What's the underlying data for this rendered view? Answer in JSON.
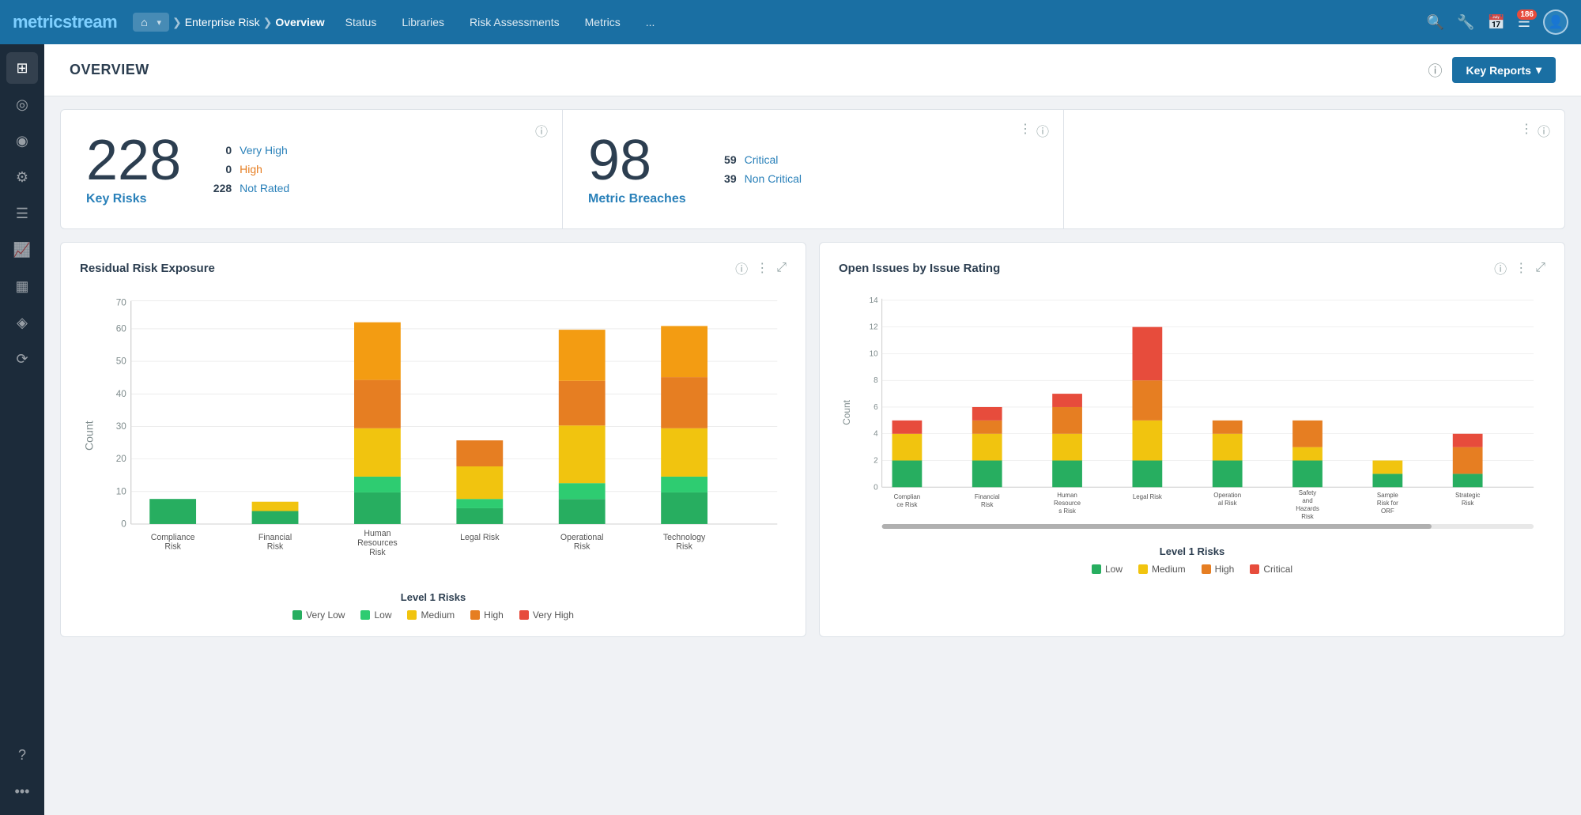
{
  "brand": {
    "name": "metricstream"
  },
  "nav": {
    "home_label": "⌂",
    "breadcrumb": [
      "Enterprise Risk",
      "Overview"
    ],
    "links": [
      "Status",
      "Libraries",
      "Risk Assessments",
      "Metrics"
    ],
    "active": "Overview",
    "more": "..."
  },
  "header": {
    "title": "OVERVIEW",
    "help_icon": "?",
    "key_reports_label": "Key Reports",
    "key_reports_dropdown": "▾"
  },
  "metrics": {
    "key_risks": {
      "count": "228",
      "label": "Key Risks",
      "very_high_count": "0",
      "very_high_label": "Very High",
      "high_count": "0",
      "high_label": "High",
      "not_rated_count": "228",
      "not_rated_label": "Not Rated"
    },
    "metric_breaches": {
      "count": "98",
      "label": "Metric Breaches",
      "critical_count": "59",
      "critical_label": "Critical",
      "non_critical_count": "39",
      "non_critical_label": "Non Critical"
    }
  },
  "residual_chart": {
    "title": "Residual Risk Exposure",
    "y_label": "Count",
    "x_label": "Level 1 Risks",
    "y_max": 70,
    "y_ticks": [
      0,
      10,
      20,
      30,
      40,
      50,
      60,
      70
    ],
    "bars": [
      {
        "label": "Compliance Risk",
        "very_low": 8,
        "low": 0,
        "medium": 0,
        "high": 0,
        "very_high": 0
      },
      {
        "label": "Financial Risk",
        "very_low": 4,
        "low": 0,
        "medium": 3,
        "high": 0,
        "very_high": 0
      },
      {
        "label": "Human Resources Risk",
        "very_low": 10,
        "low": 5,
        "medium": 15,
        "high": 15,
        "very_high": 18
      },
      {
        "label": "Legal Risk",
        "very_low": 5,
        "low": 3,
        "medium": 10,
        "high": 8,
        "very_high": 0
      },
      {
        "label": "Operational Risk",
        "very_low": 8,
        "low": 5,
        "medium": 18,
        "high": 14,
        "very_high": 16
      },
      {
        "label": "Technology Risk",
        "very_low": 10,
        "low": 5,
        "medium": 15,
        "high": 16,
        "very_high": 16
      }
    ],
    "legend": [
      {
        "label": "Very Low",
        "color": "#27ae60"
      },
      {
        "label": "Low",
        "color": "#2ecc71"
      },
      {
        "label": "Medium",
        "color": "#f1c40f"
      },
      {
        "label": "High",
        "color": "#e67e22"
      },
      {
        "label": "Very High",
        "color": "#e74c3c"
      }
    ]
  },
  "issues_chart": {
    "title": "Open Issues by Issue Rating",
    "y_label": "Count",
    "x_label": "Level 1 Risks",
    "y_max": 14,
    "y_ticks": [
      0,
      2,
      4,
      6,
      8,
      10,
      12,
      14
    ],
    "bars": [
      {
        "label": "Compliance Risk",
        "low": 2,
        "medium": 2,
        "high": 0,
        "critical": 1
      },
      {
        "label": "Financial Risk",
        "low": 2,
        "medium": 2,
        "high": 1,
        "critical": 1
      },
      {
        "label": "Human Resources Risk",
        "low": 2,
        "medium": 2,
        "high": 2,
        "critical": 1
      },
      {
        "label": "Legal Risk",
        "low": 2,
        "medium": 3,
        "high": 3,
        "critical": 4
      },
      {
        "label": "Operational Risk",
        "low": 2,
        "medium": 2,
        "high": 1,
        "critical": 0
      },
      {
        "label": "Safety and Hazards Risk",
        "low": 2,
        "medium": 1,
        "high": 2,
        "critical": 0
      },
      {
        "label": "Sample Risk for ORF",
        "low": 1,
        "medium": 1,
        "high": 0,
        "critical": 0
      },
      {
        "label": "Strategic Risk",
        "low": 1,
        "medium": 0,
        "high": 2,
        "critical": 1
      }
    ],
    "legend": [
      {
        "label": "Low",
        "color": "#27ae60"
      },
      {
        "label": "Medium",
        "color": "#f1c40f"
      },
      {
        "label": "High",
        "color": "#e67e22"
      },
      {
        "label": "Critical",
        "color": "#e74c3c"
      }
    ]
  },
  "sidebar": {
    "items": [
      {
        "icon": "⊞",
        "name": "dashboard"
      },
      {
        "icon": "◎",
        "name": "globe"
      },
      {
        "icon": "◉",
        "name": "target"
      },
      {
        "icon": "⚙",
        "name": "settings-gear"
      },
      {
        "icon": "☰",
        "name": "list"
      },
      {
        "icon": "📈",
        "name": "chart"
      },
      {
        "icon": "▦",
        "name": "grid"
      },
      {
        "icon": "◈",
        "name": "shield"
      },
      {
        "icon": "⟳",
        "name": "refresh"
      },
      {
        "icon": "☰",
        "name": "menu2"
      },
      {
        "icon": "?",
        "name": "help"
      },
      {
        "icon": "…",
        "name": "more"
      }
    ]
  }
}
